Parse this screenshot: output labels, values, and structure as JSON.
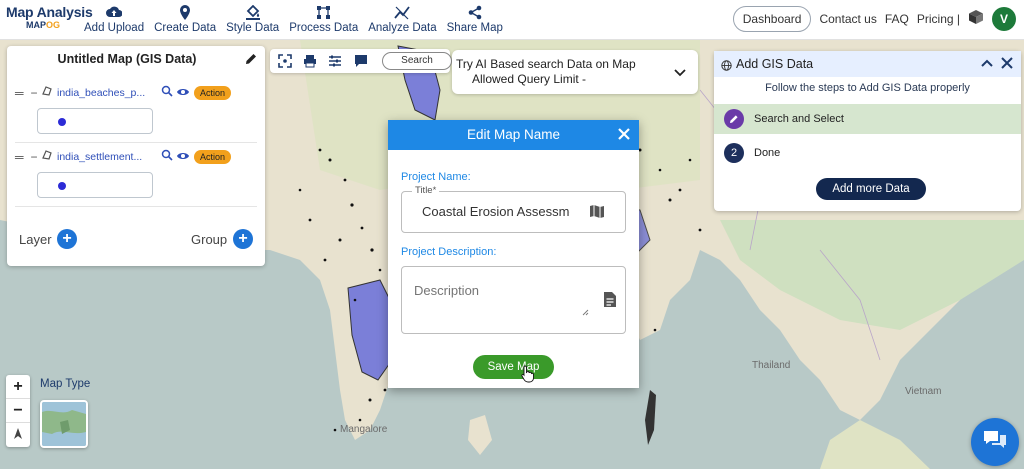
{
  "brand": {
    "title": "Map Analysis",
    "sub_a": "MAP",
    "sub_b": "OG"
  },
  "nav": {
    "items": [
      {
        "label": "Add Upload",
        "icon": "cloud-upload-icon"
      },
      {
        "label": "Create Data",
        "icon": "map-pin-icon"
      },
      {
        "label": "Style Data",
        "icon": "paint-bucket-icon"
      },
      {
        "label": "Process Data",
        "icon": "vector-process-icon"
      },
      {
        "label": "Analyze Data",
        "icon": "analyze-icon"
      },
      {
        "label": "Share Map",
        "icon": "share-icon"
      }
    ],
    "dashboard": "Dashboard",
    "contact": "Contact us",
    "faq": "FAQ",
    "pricing": "Pricing |",
    "avatar_initial": "V"
  },
  "layer_panel": {
    "title": "Untitled Map (GIS Data)",
    "layers": [
      {
        "name": "india_beaches_p...",
        "action": "Action"
      },
      {
        "name": "india_settlement...",
        "action": "Action"
      }
    ],
    "layer_label": "Layer",
    "group_label": "Group"
  },
  "tools": {
    "search_label": "Search"
  },
  "ai_banner": {
    "line1": "Try AI Based search Data on Map",
    "line2": "Allowed Query Limit -"
  },
  "gis_panel": {
    "title": "Add GIS Data",
    "subtitle": "Follow the steps to Add GIS Data properly",
    "steps": [
      {
        "label": "Search and Select",
        "active": true
      },
      {
        "num": "2",
        "label": "Done",
        "active": false
      }
    ],
    "add_more": "Add more Data"
  },
  "modal": {
    "title": "Edit Map Name",
    "project_name_label": "Project Name:",
    "title_legend": "Title*",
    "title_value": "Coastal Erosion Assessment",
    "project_description_label": "Project Description:",
    "description_placeholder": "Description",
    "save_label": "Save Map"
  },
  "map": {
    "type_label": "Map Type",
    "zoom_in": "+",
    "zoom_out": "−",
    "labels": [
      "Mangalore",
      "Thailand",
      "Vietnam"
    ]
  },
  "colors": {
    "accent": "#1e88e5",
    "brand": "#1d3a6b",
    "save": "#3a9a2a",
    "action": "#f2a01c",
    "polygon": "#7b7fd8"
  }
}
